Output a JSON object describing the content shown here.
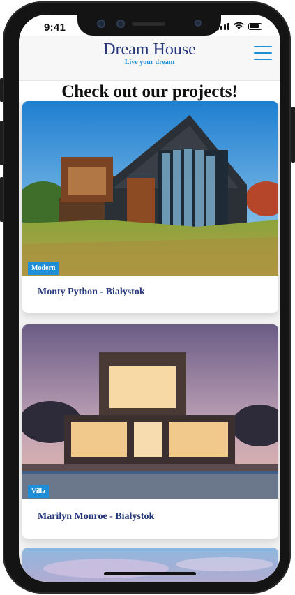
{
  "status_bar": {
    "time": "9:41"
  },
  "header": {
    "brand_title": "Dream House",
    "brand_tagline": "Live your dream",
    "menu_icon": "hamburger-menu-icon",
    "brand_color": "#25367a",
    "accent_color": "#1f8ed8"
  },
  "main": {
    "title": "Check out our projects!",
    "projects": [
      {
        "badge": "Modern",
        "title": "Monty Python - Białystok"
      },
      {
        "badge": "Villa",
        "title": "Marilyn Monroe - Białystok"
      }
    ]
  }
}
